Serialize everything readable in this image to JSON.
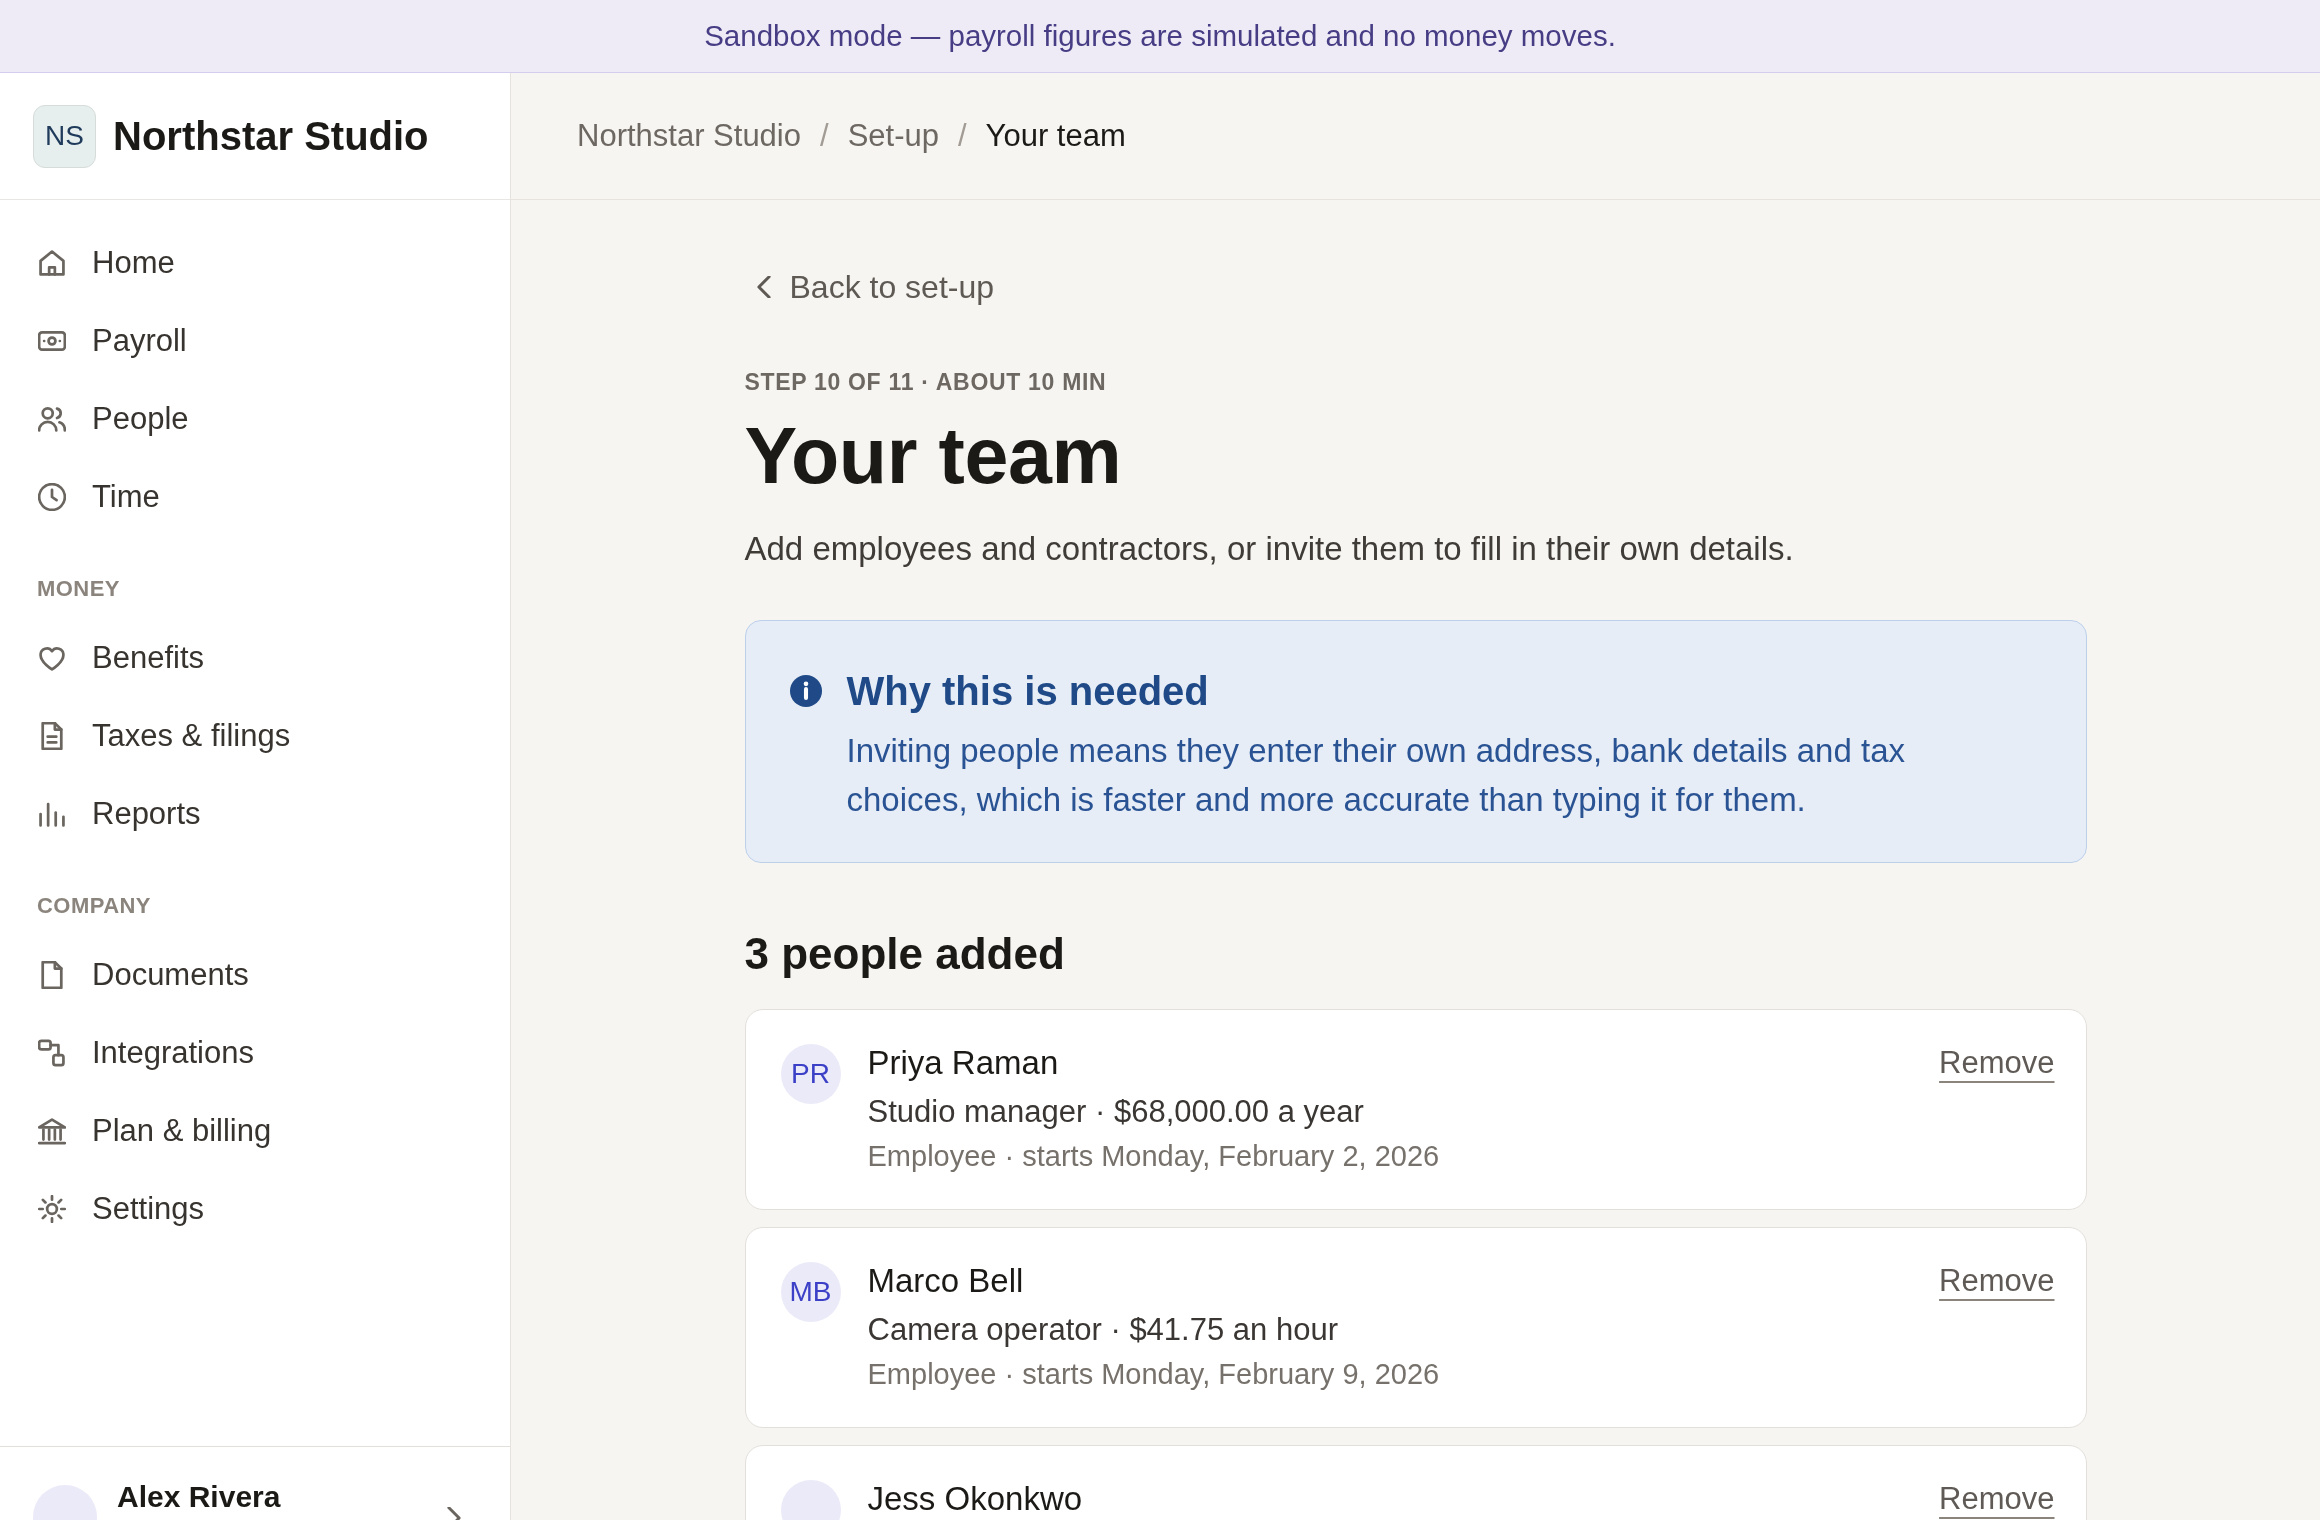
{
  "banner": {
    "text": "Sandbox mode — payroll figures are simulated and no money moves."
  },
  "sidebar": {
    "brand": {
      "initials": "NS",
      "name": "Northstar Studio"
    },
    "sections": [
      {
        "items": [
          {
            "label": "Home",
            "selected": false
          },
          {
            "label": "Payroll",
            "selected": false
          },
          {
            "label": "People",
            "selected": false
          },
          {
            "label": "Time",
            "selected": false
          }
        ]
      },
      {
        "heading": "MONEY",
        "items": [
          {
            "label": "Benefits",
            "selected": false
          },
          {
            "label": "Taxes & filings",
            "selected": false
          },
          {
            "label": "Reports",
            "selected": false
          }
        ]
      },
      {
        "heading": "COMPANY",
        "items": [
          {
            "label": "Documents",
            "selected": false
          },
          {
            "label": "Integrations",
            "selected": false
          },
          {
            "label": "Plan & billing",
            "selected": false
          },
          {
            "label": "Settings",
            "selected": false
          }
        ]
      }
    ],
    "user": {
      "name": "Alex Rivera"
    }
  },
  "breadcrumb": [
    {
      "label": "Northstar Studio",
      "current": false
    },
    {
      "separator": "/",
      "label": "Set-up",
      "current": false
    },
    {
      "separator": "/",
      "label": "Your team",
      "current": true
    }
  ],
  "page": {
    "back_link": "Back to set-up",
    "step": "STEP 10 OF 11 · ABOUT 10 MIN",
    "title": "Your team",
    "subtitle": "Add employees and contractors, or invite them to fill in their own details.",
    "notice": {
      "title": "Why this is needed",
      "text": "Inviting people means they enter their own address, bank details and tax choices, which is faster and more accurate than typing it for them."
    }
  },
  "team": {
    "heading": "3 people added",
    "people": [
      {
        "initials": "PR",
        "name": "Priya Raman",
        "summary": "Studio manager · $68,000.00 a year",
        "detail": "Employee · starts Monday, February 2, 2026",
        "action": "Remove"
      },
      {
        "initials": "MB",
        "name": "Marco Bell",
        "summary": "Camera operator · $41.75 an hour",
        "detail": "Employee · starts Monday, February 9, 2026",
        "action": "Remove"
      },
      {
        "name": "Jess Okonkwo",
        "action": "Remove"
      }
    ]
  }
}
